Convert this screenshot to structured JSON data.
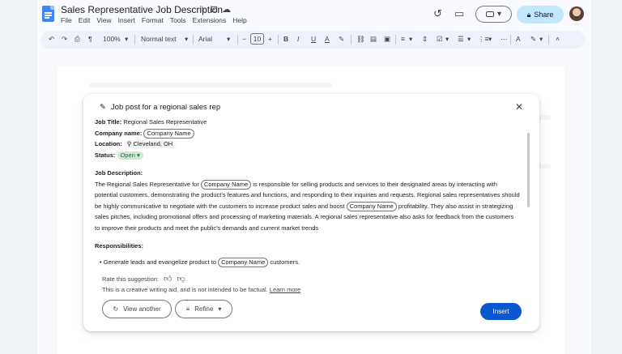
{
  "doc": {
    "title": "Sales Representative Job Description",
    "title_icons": [
      "star-icon",
      "folder-icon",
      "cloud-icon"
    ],
    "menu": [
      "File",
      "Edit",
      "View",
      "Insert",
      "Format",
      "Tools",
      "Extensions",
      "Help"
    ]
  },
  "header": {
    "share_label": "Share",
    "icons": [
      "history-icon",
      "comment-icon",
      "video-call-icon",
      "lock-icon",
      "avatar"
    ]
  },
  "toolbar": {
    "undo": "↶",
    "redo": "↷",
    "print": "⎙",
    "paint": "¶",
    "zoom": "100%",
    "style": "Normal text",
    "font": "Arial",
    "minus": "−",
    "size": "10",
    "plus": "+",
    "bold": "B",
    "italic": "I",
    "underline": "U",
    "text_color": "A",
    "highlight": "✎",
    "link": "⛓",
    "comment": "▤",
    "image": "▣",
    "align": "≡",
    "spacing": "⇕",
    "checklist": "☑",
    "bullets": "☰",
    "numbered": "⋮≡",
    "more": "⋯",
    "spell": "A",
    "edit_mode": "✎",
    "collapse": "˄"
  },
  "panel": {
    "title": "Job post for a regional sales rep",
    "job_title_label": "Job Title:",
    "job_title_value": "Regional Sales Representative",
    "company_label": "Company name:",
    "company_chip": "Company Name",
    "location_label": "Location:",
    "location_pin": "⚲",
    "location_value": "Cleveland, OH",
    "status_label": "Status:",
    "status_value": "Open",
    "status_caret": "▾",
    "desc_heading": "Job Description:",
    "desc_part1": "The Regional Sales Representative for",
    "desc_part2": "is responsible for selling products and services to their designated areas by interacting with potential customers, demonstrating the product's features and functions, and responding to their inquiries and requests. Regional sales representatives should be highly communicative to negotiate with the customers to increase product sales and boost",
    "desc_part3": "profitability. They also assist in strategizing sales pitches, including promotional offers and processing of marketing materials. A regional sales representative also asks for feedback from the customers to improve their products and meet the public's demands and current market trends",
    "resp_heading": "Responsibilities:",
    "resp_part1": "Generate leads and evangelize product to",
    "resp_part2": "customers.",
    "rate_label": "Rate this suggestion:",
    "disclaimer": "This is a creative writing aid, and is not intended to be factual.",
    "learn_more": "Learn more",
    "view_another": "View another",
    "refine": "Refine",
    "insert": "Insert"
  }
}
